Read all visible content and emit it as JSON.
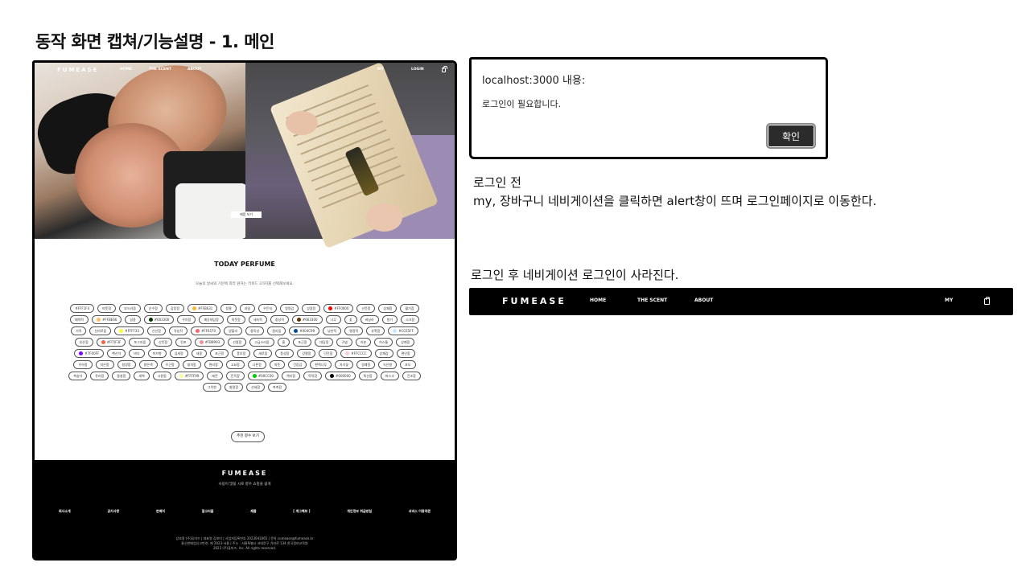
{
  "title": "동작 화면 캡쳐/기능설명 - 1. 메인",
  "site": {
    "nav": {
      "logo": "FUMEASE",
      "home": "HOME",
      "scent": "THE SCENT",
      "about": "ABOUT",
      "my": "MY",
      "login": "LOGIN",
      "cart_icon": "shopping-bag-icon"
    },
    "hero_button": "제품 보기",
    "today": {
      "heading": "TODAY PERFUME",
      "subtitle": "오늘의 날씨와 기분에 따라 원하는 키워드 3가지를 선택해보세요."
    },
    "keywords": [
      {
        "label": "#FFF1F4",
        "color": ""
      },
      {
        "label": "따뜻함",
        "color": ""
      },
      {
        "label": "부드러움",
        "color": ""
      },
      {
        "label": "순수함",
        "color": ""
      },
      {
        "label": "감탕함",
        "color": ""
      },
      {
        "label": "#FFB631",
        "color": "#FFB631"
      },
      {
        "label": "청결",
        "color": ""
      },
      {
        "label": "과일",
        "color": ""
      },
      {
        "label": "우든지",
        "color": ""
      },
      {
        "label": "청량감",
        "color": ""
      },
      {
        "label": "상큼함",
        "color": ""
      },
      {
        "label": "#FF0000",
        "color": "#FF0000"
      },
      {
        "label": "산뜻함",
        "color": ""
      },
      {
        "label": "상쾌함",
        "color": ""
      },
      {
        "label": "활기참",
        "color": ""
      },
      {
        "label": "매력적",
        "color": ""
      },
      {
        "label": "#FFBE66",
        "color": "#FFBE66"
      },
      {
        "label": "달콤",
        "color": ""
      },
      {
        "label": "#003300",
        "color": "#003300"
      },
      {
        "label": "우아함",
        "color": ""
      },
      {
        "label": "깨끗대담함",
        "color": ""
      },
      {
        "label": "따뜻함",
        "color": ""
      },
      {
        "label": "세속적",
        "color": ""
      },
      {
        "label": "중성적",
        "color": ""
      },
      {
        "label": "#663300",
        "color": "#663300"
      },
      {
        "label": "나무",
        "color": ""
      },
      {
        "label": "꽃",
        "color": ""
      },
      {
        "label": "바닐라",
        "color": ""
      },
      {
        "label": "향기",
        "color": ""
      },
      {
        "label": "시크함",
        "color": ""
      },
      {
        "label": "가족",
        "color": ""
      },
      {
        "label": "신비로움",
        "color": ""
      },
      {
        "label": "#FFFF33",
        "color": "#FFFF33"
      },
      {
        "label": "신선함",
        "color": ""
      },
      {
        "label": "귀농적",
        "color": ""
      },
      {
        "label": "#FF6570",
        "color": "#FF6570"
      },
      {
        "label": "양불리",
        "color": ""
      },
      {
        "label": "중독성",
        "color": ""
      },
      {
        "label": "질리움",
        "color": ""
      },
      {
        "label": "#004C99",
        "color": "#004C99"
      },
      {
        "label": "낭만적",
        "color": ""
      },
      {
        "label": "열정적",
        "color": ""
      },
      {
        "label": "유혹함",
        "color": ""
      },
      {
        "label": "#CCE5FF",
        "color": "#CCE5FF"
      },
      {
        "label": "온은함",
        "color": ""
      },
      {
        "label": "#FF5F3F",
        "color": "#FF5F3F"
      },
      {
        "label": "포그러움",
        "color": ""
      },
      {
        "label": "산뜻함",
        "color": ""
      },
      {
        "label": "된포",
        "color": ""
      },
      {
        "label": "#FB8993",
        "color": "#FB8993"
      },
      {
        "label": "선명함",
        "color": ""
      },
      {
        "label": "고급스러움",
        "color": ""
      },
      {
        "label": "흙",
        "color": ""
      },
      {
        "label": "포근함",
        "color": ""
      },
      {
        "label": "대담함",
        "color": ""
      },
      {
        "label": "귀엽",
        "color": ""
      },
      {
        "label": "차분",
        "color": ""
      },
      {
        "label": "허스툼",
        "color": ""
      },
      {
        "label": "상쾌함",
        "color": ""
      },
      {
        "label": "#7F00FF",
        "color": "#7F00FF"
      },
      {
        "label": "햇산석",
        "color": ""
      },
      {
        "label": "바다",
        "color": ""
      },
      {
        "label": "허브향",
        "color": ""
      },
      {
        "label": "섬세함",
        "color": ""
      },
      {
        "label": "새콤",
        "color": ""
      },
      {
        "label": "포근함",
        "color": ""
      },
      {
        "label": "풍부함",
        "color": ""
      },
      {
        "label": "새로움",
        "color": ""
      },
      {
        "label": "풍성함",
        "color": ""
      },
      {
        "label": "강렬함",
        "color": ""
      },
      {
        "label": "단단함",
        "color": ""
      },
      {
        "label": "#FFCCCC",
        "color": "#FFCCCC"
      },
      {
        "label": "상쾌감",
        "color": ""
      },
      {
        "label": "편안함",
        "color": ""
      },
      {
        "label": "우아함",
        "color": ""
      },
      {
        "label": "지은함",
        "color": ""
      },
      {
        "label": "청량함",
        "color": ""
      },
      {
        "label": "맑은색",
        "color": ""
      },
      {
        "label": "우근함",
        "color": ""
      },
      {
        "label": "창의함",
        "color": ""
      },
      {
        "label": "편리함",
        "color": ""
      },
      {
        "label": "고요함",
        "color": ""
      },
      {
        "label": "나른함",
        "color": ""
      },
      {
        "label": "따뜻",
        "color": ""
      },
      {
        "label": "건장감",
        "color": ""
      },
      {
        "label": "편백나무",
        "color": ""
      },
      {
        "label": "자기꽃",
        "color": ""
      },
      {
        "label": "경쾌함",
        "color": ""
      },
      {
        "label": "녹은향",
        "color": ""
      },
      {
        "label": "포도",
        "color": ""
      },
      {
        "label": "복숭아",
        "color": ""
      },
      {
        "label": "쥬라함",
        "color": ""
      },
      {
        "label": "중층함",
        "color": ""
      },
      {
        "label": "세백",
        "color": ""
      },
      {
        "label": "시원함",
        "color": ""
      },
      {
        "label": "#FFFF99",
        "color": "#FFFF99"
      },
      {
        "label": "레몬",
        "color": ""
      },
      {
        "label": "진득함",
        "color": ""
      },
      {
        "label": "#00CC00",
        "color": "#00CC00"
      },
      {
        "label": "액티함",
        "color": ""
      },
      {
        "label": "묵직함",
        "color": ""
      },
      {
        "label": "#000000",
        "color": "#000000"
      },
      {
        "label": "특선함",
        "color": ""
      },
      {
        "label": "머스크",
        "color": ""
      },
      {
        "label": "건조함",
        "color": ""
      },
      {
        "label": "그윽한",
        "color": ""
      },
      {
        "label": "발랄함",
        "color": ""
      },
      {
        "label": "선세함",
        "color": ""
      },
      {
        "label": "촉촉함",
        "color": ""
      }
    ],
    "recommend_button": "추천 향수 보기",
    "footer": {
      "logo": "FUMEASE",
      "tagline": "사용이 많을 시로 향수 쇼핑을 쉽게",
      "links": [
        "회사소개",
        "공지사항",
        "판매처",
        "알고리즘",
        "제품",
        "[ 계그해보 ]",
        "개인정보 취급방침",
        "서비스 이용약관"
      ],
      "info1": "상호명 (주)퓨미즈 | 대표명 김보미 | 사업자등록번호 2023041065 | 문의 cumease@fumease.kr",
      "info2": "통신판매업신고번호: 제 2023-서울 | 주소 : 서울특별시 서대문구 가좌로 134 한국정보교육원",
      "info3": "2023 (주)퓨미즈, Inc. All rights reserved."
    }
  },
  "alert": {
    "host": "localhost:3000 내용:",
    "message": "로그인이 필요합니다.",
    "ok": "확인"
  },
  "desc_before": {
    "line1": "로그인 전",
    "line2": "my, 장바구니 네비게이션을 클릭하면 alert창이 뜨며 로그인페이지로 이동한다."
  },
  "desc_after": "로그인 후 네비게이션 로그인이 사라진다.",
  "navbar_after": {
    "logo": "FUMEASE",
    "home": "HOME",
    "scent": "THE SCENT",
    "about": "ABOUT",
    "my": "MY",
    "cart_icon": "shopping-bag-icon"
  }
}
